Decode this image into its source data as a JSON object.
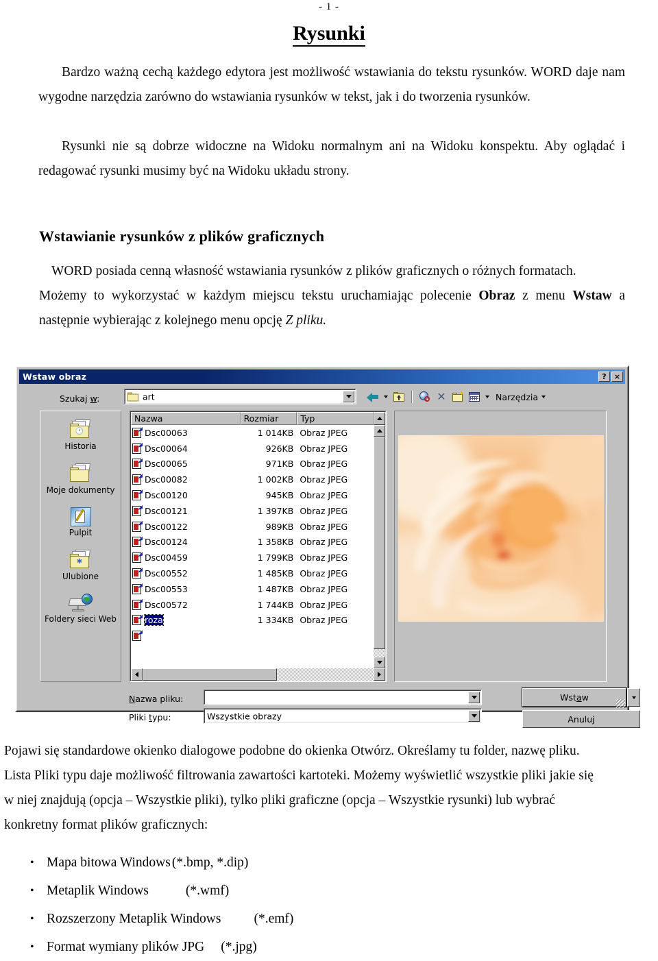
{
  "document": {
    "page_number": "- 1 -",
    "title": "Rysunki",
    "paragraph_1": "Bardzo ważną cechą każdego edytora jest możliwość wstawiania do tekstu rysunków. WORD daje nam wygodne narzędzia zarówno do wstawiania rysunków w tekst, jak i do tworzenia rysunków.",
    "paragraph_2": "Rysunki nie są dobrze widoczne na Widoku normalnym ani na Widoku konspektu. Aby oglądać i redagować rysunki musimy być na Widoku układu strony.",
    "heading_2": "Wstawianie rysunków z plików graficznych",
    "paragraph_3_line1": "WORD posiada cenną własność wstawiania rysunków z plików graficznych o różnych formatach.",
    "paragraph_3_line2": "Możemy to wykorzystać w każdym miejscu tekstu uruchamiając polecenie Obraz z menu Wstaw a następnie wybierając z kolejnego menu opcję Z pliku.",
    "paragraph_3_b1": "Obraz",
    "paragraph_3_b2": "Wstaw",
    "paragraph_3_i1": "Z pliku.",
    "paragraph_4_line1": "Pojawi się standardowe okienko dialogowe podobne do okienka Otwórz. Określamy tu folder, nazwę pliku.",
    "paragraph_4_line2": "Lista Pliki typu daje możliwość filtrowania zawartości kartoteki. Możemy wyświetlić wszystkie pliki jakie się",
    "paragraph_4_line3": "w niej znajdują (opcja – Wszystkie pliki), tylko pliki graficzne (opcja – Wszystkie rysunki) lub wybrać",
    "paragraph_4_line4": "konkretny format plików graficznych:",
    "bullets": [
      {
        "label": "Mapa bitowa Windows",
        "ext": "(*.bmp, *.dip)"
      },
      {
        "label": "Metaplik Windows",
        "ext": "(*.wmf)"
      },
      {
        "label": "Rozszerzony Metaplik Windows",
        "ext": "(*.emf)"
      },
      {
        "label": "Format wymiany plików JPG",
        "ext": "(*.jpg)"
      }
    ]
  },
  "dialog": {
    "title": "Wstaw obraz",
    "help_button": "?",
    "close_button": "×",
    "lookin_label": "Szukaj w:",
    "lookin_value": "art",
    "toolbar": {
      "back_icon": "back-arrow-icon",
      "back_dropdown": "chevron-down-icon",
      "up_icon": "up-one-level-icon",
      "search_web_icon": "search-web-icon",
      "delete_icon": "delete-icon",
      "new_folder_icon": "new-folder-icon",
      "views_icon": "views-icon",
      "views_dropdown": "chevron-down-icon",
      "tools_label": "Narzędzia",
      "tools_dropdown": "chevron-down-icon"
    },
    "places": [
      {
        "label": "Historia",
        "icon": "history-folder-icon"
      },
      {
        "label": "Moje dokumenty",
        "icon": "my-documents-icon"
      },
      {
        "label": "Pulpit",
        "icon": "desktop-icon"
      },
      {
        "label": "Ulubione",
        "icon": "favorites-icon"
      },
      {
        "label": "Foldery sieci Web",
        "icon": "web-folders-icon"
      }
    ],
    "columns": [
      "Nazwa",
      "Rozmiar",
      "Typ"
    ],
    "files": [
      {
        "name": "Dsc00063",
        "size": "1 014KB",
        "type": "Obraz JPEG",
        "selected": false
      },
      {
        "name": "Dsc00064",
        "size": "926KB",
        "type": "Obraz JPEG",
        "selected": false
      },
      {
        "name": "Dsc00065",
        "size": "971KB",
        "type": "Obraz JPEG",
        "selected": false
      },
      {
        "name": "Dsc00082",
        "size": "1 002KB",
        "type": "Obraz JPEG",
        "selected": false
      },
      {
        "name": "Dsc00120",
        "size": "945KB",
        "type": "Obraz JPEG",
        "selected": false
      },
      {
        "name": "Dsc00121",
        "size": "1 397KB",
        "type": "Obraz JPEG",
        "selected": false
      },
      {
        "name": "Dsc00122",
        "size": "989KB",
        "type": "Obraz JPEG",
        "selected": false
      },
      {
        "name": "Dsc00124",
        "size": "1 358KB",
        "type": "Obraz JPEG",
        "selected": false
      },
      {
        "name": "Dsc00459",
        "size": "1 799KB",
        "type": "Obraz JPEG",
        "selected": false
      },
      {
        "name": "Dsc00552",
        "size": "1 485KB",
        "type": "Obraz JPEG",
        "selected": false
      },
      {
        "name": "Dsc00553",
        "size": "1 487KB",
        "type": "Obraz JPEG",
        "selected": false
      },
      {
        "name": "Dsc00572",
        "size": "1 744KB",
        "type": "Obraz JPEG",
        "selected": false
      },
      {
        "name": "roza",
        "size": "1 334KB",
        "type": "Obraz JPEG",
        "selected": true
      }
    ],
    "preview_alt": "rose-photo-preview",
    "filename_label": "Nazwa pliku:",
    "filename_value": "",
    "filetype_label": "Pliki typu:",
    "filetype_value": "Wszystkie obrazy",
    "insert_button": "Wstaw",
    "cancel_button": "Anuluj"
  },
  "colors": {
    "titlebar_start": "#0a246a",
    "titlebar_end": "#4d8fe0",
    "dialog_face": "#c0c0c0",
    "selection": "#000080",
    "rose": "#f0a868"
  }
}
